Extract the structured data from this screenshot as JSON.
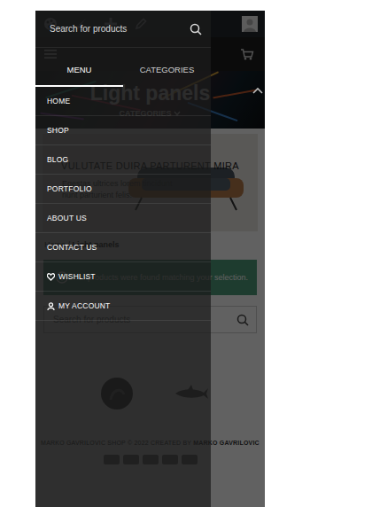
{
  "menu_panel": {
    "search": {
      "placeholder": "Search for products"
    },
    "tabs": [
      {
        "label": "MENU",
        "selected": true
      },
      {
        "label": "CATEGORIES",
        "selected": false
      }
    ],
    "items": [
      {
        "label": "HOME",
        "kind": "link"
      },
      {
        "label": "SHOP",
        "kind": "link"
      },
      {
        "label": "BLOG",
        "kind": "link"
      },
      {
        "label": "PORTFOLIO",
        "kind": "link"
      },
      {
        "label": "ABOUT US",
        "kind": "link"
      },
      {
        "label": "CONTACT US",
        "kind": "link"
      },
      {
        "label": "WISHLIST",
        "kind": "wishlist"
      },
      {
        "label": "MY ACCOUNT",
        "kind": "account"
      }
    ]
  },
  "page": {
    "title": "Light panels",
    "categories_toggle": "CATEGORIES",
    "banner": {
      "heading": "VULUTATE DUIRA PARTURENT MIRA",
      "lines": [
        "Egestas ultrices lorem tincidunt",
        "nunt parturient felis."
      ]
    },
    "breadcrumb": {
      "home": "Home",
      "separator": " / ",
      "current": "Light panels"
    },
    "notice": "No products were found matching your selection.",
    "search": {
      "placeholder": "Search for products"
    },
    "footer": {
      "copyright": "MARKO GAVRILOVIC SHOP © 2022 CREATED BY ",
      "author": "MARKO GAVRILOVIC"
    }
  }
}
